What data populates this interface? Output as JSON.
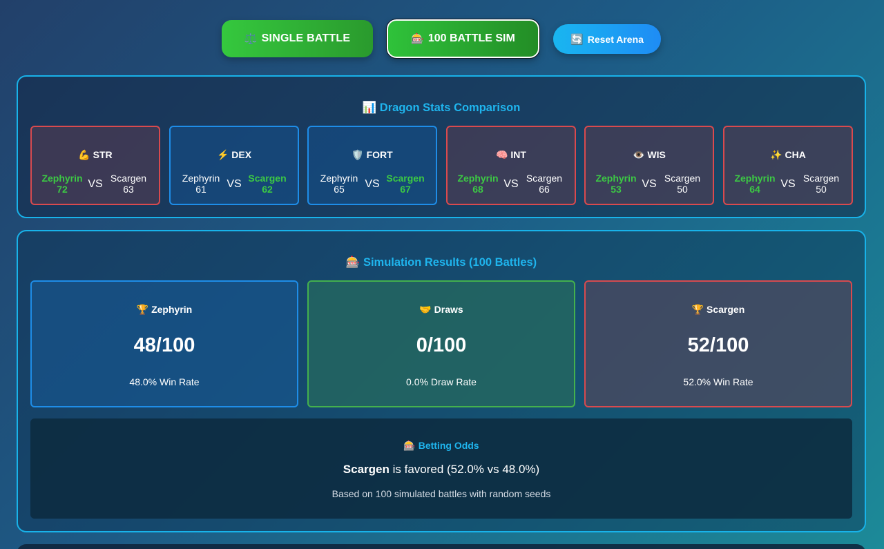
{
  "toolbar": {
    "single_icon": "⚖️",
    "single_label": "SINGLE BATTLE",
    "sim_icon": "🎰",
    "sim_label": "100 BATTLE SIM",
    "reset_icon": "🔄",
    "reset_label": "Reset Arena"
  },
  "stats": {
    "title": "📊 Dragon Stats Comparison",
    "vs_label": "VS",
    "items": [
      {
        "name": "💪 STR",
        "left_name": "Zephyrin",
        "left_value": "72",
        "right_name": "Scargen",
        "right_value": "63",
        "winner": "left",
        "color": "red"
      },
      {
        "name": "⚡ DEX",
        "left_name": "Zephyrin",
        "left_value": "61",
        "right_name": "Scargen",
        "right_value": "62",
        "winner": "right",
        "color": "blue"
      },
      {
        "name": "🛡️ FORT",
        "left_name": "Zephyrin",
        "left_value": "65",
        "right_name": "Scargen",
        "right_value": "67",
        "winner": "right",
        "color": "blue"
      },
      {
        "name": "🧠 INT",
        "left_name": "Zephyrin",
        "left_value": "68",
        "right_name": "Scargen",
        "right_value": "66",
        "winner": "left",
        "color": "red"
      },
      {
        "name": "👁️ WIS",
        "left_name": "Zephyrin",
        "left_value": "53",
        "right_name": "Scargen",
        "right_value": "50",
        "winner": "left",
        "color": "red"
      },
      {
        "name": "✨ CHA",
        "left_name": "Zephyrin",
        "left_value": "64",
        "right_name": "Scargen",
        "right_value": "50",
        "winner": "left",
        "color": "red"
      }
    ]
  },
  "simulation": {
    "title": "🎰 Simulation Results (100 Battles)",
    "results": [
      {
        "label": "🏆 Zephyrin",
        "score": "48/100",
        "rate": "48.0% Win Rate",
        "color": "blue"
      },
      {
        "label": "🤝 Draws",
        "score": "0/100",
        "rate": "0.0% Draw Rate",
        "color": "green"
      },
      {
        "label": "🏆 Scargen",
        "score": "52/100",
        "rate": "52.0% Win Rate",
        "color": "red"
      }
    ],
    "odds": {
      "title": "🎰 Betting Odds",
      "favorite": "Scargen",
      "favored_text": " is favored (52.0% vs 48.0%)",
      "note": "Based on 100 simulated battles with random seeds"
    }
  },
  "colors": {
    "accent": "#1fb5ee",
    "win_green": "#3cc944",
    "border_red": "#d94a4e",
    "border_blue": "#1e8de8",
    "border_green": "#44b14d"
  }
}
